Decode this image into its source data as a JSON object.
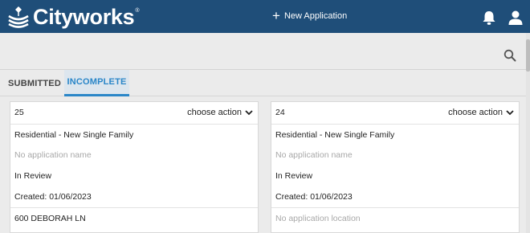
{
  "header": {
    "brand": "Cityworks",
    "trademark": "®",
    "new_application_label": "New Application",
    "colors": {
      "bar": "#1f4e79",
      "text": "#ffffff"
    }
  },
  "tabs": [
    {
      "label": "SUBMITTED",
      "active": false
    },
    {
      "label": "INCOMPLETE",
      "active": true
    }
  ],
  "cards": [
    {
      "id": "25",
      "action_label": "choose action",
      "type": "Residential - New Single Family",
      "name": "No application name",
      "status": "In Review",
      "created": "Created: 01/06/2023",
      "location": "600 DEBORAH LN"
    },
    {
      "id": "24",
      "action_label": "choose action",
      "type": "Residential - New Single Family",
      "name": "No application name",
      "status": "In Review",
      "created": "Created: 01/06/2023",
      "location": "No application location"
    }
  ],
  "icons": [
    "cityworks-logo-icon",
    "plus-icon",
    "bell-icon",
    "user-icon",
    "search-icon",
    "chevron-down-icon"
  ]
}
